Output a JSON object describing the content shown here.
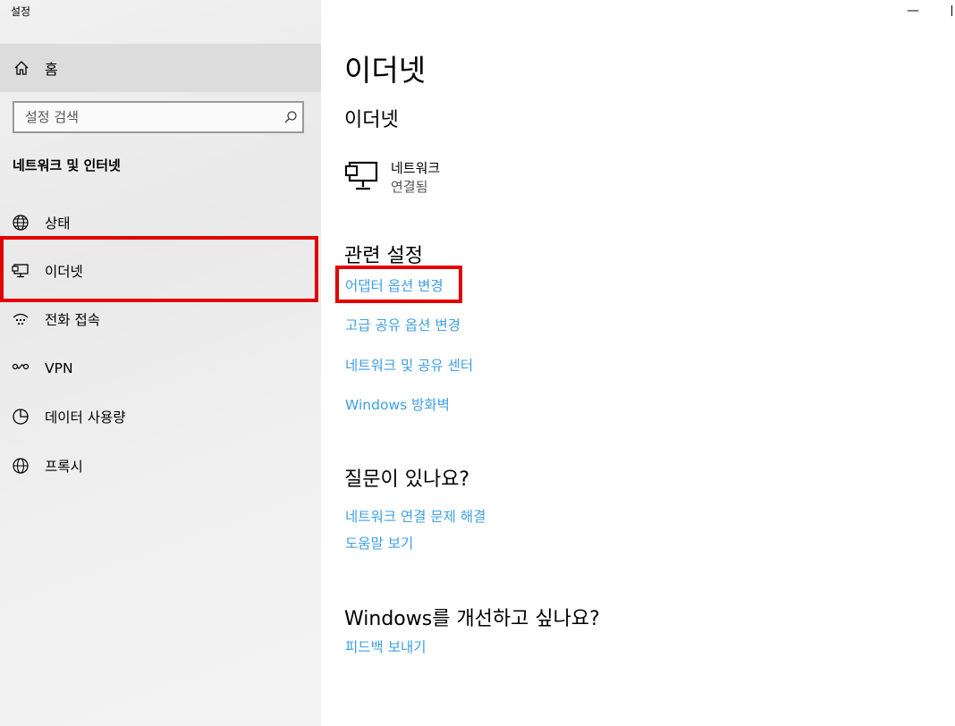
{
  "window": {
    "title": "설정",
    "minimize_symbol": "—"
  },
  "sidebar": {
    "home_label": "홈",
    "search_placeholder": "설정 검색",
    "section_title": "네트워크 및 인터넷",
    "items": [
      {
        "label": "상태",
        "icon": "globe-status-icon"
      },
      {
        "label": "이더넷",
        "icon": "ethernet-icon",
        "selected": true
      },
      {
        "label": "전화 접속",
        "icon": "dialup-icon"
      },
      {
        "label": "VPN",
        "icon": "vpn-icon"
      },
      {
        "label": "데이터 사용량",
        "icon": "data-usage-icon"
      },
      {
        "label": "프록시",
        "icon": "globe-icon"
      }
    ]
  },
  "main": {
    "page_title": "이더넷",
    "ethernet_heading": "이더넷",
    "network": {
      "name": "네트워크",
      "status": "연결됨"
    },
    "related_heading": "관련 설정",
    "related_links": [
      "어댑터 옵션 변경",
      "고급 공유 옵션 변경",
      "네트워크 및 공유 센터",
      "Windows 방화벽"
    ],
    "question_heading": "질문이 있나요?",
    "question_links": [
      "네트워크 연결 문제 해결",
      "도움말 보기"
    ],
    "improve_heading": "Windows를 개선하고 싶나요?",
    "improve_links": [
      "피드백 보내기"
    ]
  },
  "colors": {
    "link": "#3d9fe6",
    "highlight": "#e30000",
    "home_bg": "#dcdcdc"
  }
}
